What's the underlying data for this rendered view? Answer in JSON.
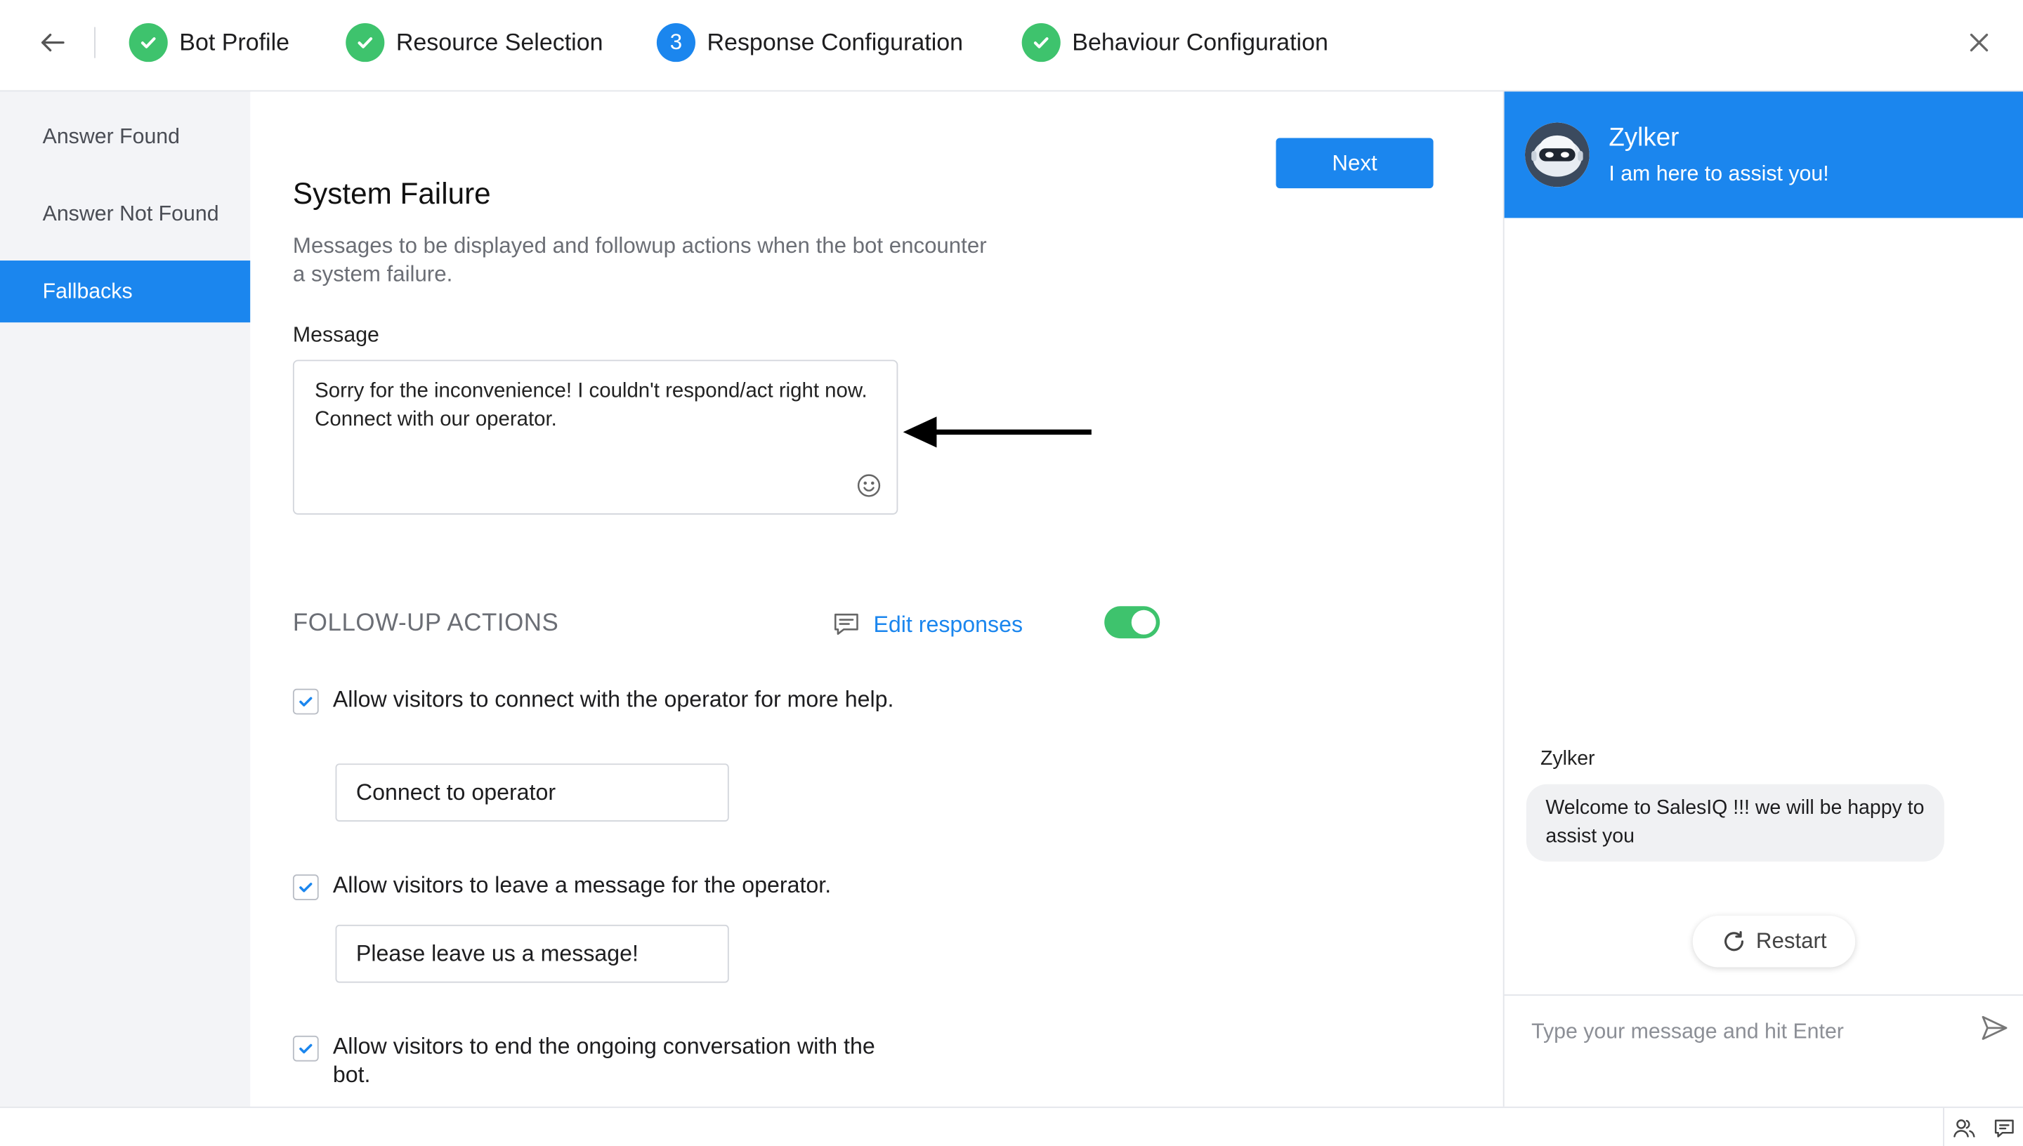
{
  "header": {
    "steps": [
      {
        "label": "Bot Profile",
        "status": "done"
      },
      {
        "label": "Resource Selection",
        "status": "done"
      },
      {
        "label": "Response Configuration",
        "status": "current",
        "number": "3"
      },
      {
        "label": "Behaviour Configuration",
        "status": "done"
      }
    ],
    "icons": {
      "back": "arrow-left-icon",
      "close": "close-icon",
      "done": "check-icon"
    }
  },
  "sidebar": {
    "items": [
      {
        "label": "Answer Found",
        "active": false
      },
      {
        "label": "Answer Not Found",
        "active": false
      },
      {
        "label": "Fallbacks",
        "active": true
      }
    ]
  },
  "main": {
    "next_label": "Next",
    "title": "System Failure",
    "description": "Messages to be displayed and followup actions when the bot encounter a system failure.",
    "message_label": "Message",
    "message_value": "Sorry for the inconvenience! I couldn't respond/act right now. Connect with our operator.",
    "followup_title": "FOLLOW-UP ACTIONS",
    "edit_responses_label": "Edit responses",
    "toggle_on": true,
    "options": [
      {
        "label": "Allow visitors to connect with the operator for more help.",
        "checked": true,
        "input_value": "Connect to operator"
      },
      {
        "label": "Allow visitors to leave a message for the operator.",
        "checked": true,
        "input_value": "Please leave us a message!"
      },
      {
        "label": "Allow visitors to end the ongoing conversation with the bot.",
        "checked": true
      }
    ]
  },
  "preview": {
    "bot_name": "Zylker",
    "tagline": "I am here to assist you!",
    "message_sender": "Zylker",
    "welcome_message": "Welcome to SalesIQ !!! we will be happy to assist you",
    "restart_label": "Restart",
    "input_placeholder": "Type your message and hit Enter"
  },
  "colors": {
    "accent": "#1b86ee",
    "success": "#3ec36d",
    "sidebar_bg": "#f3f4f7",
    "text_muted": "#6b6e75"
  }
}
